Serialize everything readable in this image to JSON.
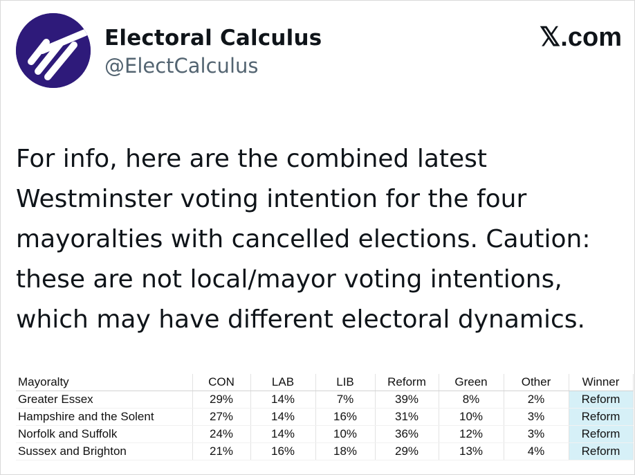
{
  "account": {
    "display_name": "Electoral Calculus",
    "handle": "@ElectCalculus",
    "brand": "𝕏.com",
    "avatar_icon": "electoral-calculus-logo",
    "avatar_color": "#2e1a7a"
  },
  "tweet": {
    "lines": [
      "For info, here are the combined latest",
      "Westminster voting intention for the four",
      "mayoralties with cancelled elections. Caution:",
      "these are not local/mayor voting intentions,",
      "which may have different electoral dynamics."
    ]
  },
  "table": {
    "headers": [
      "Mayoralty",
      "CON",
      "LAB",
      "LIB",
      "Reform",
      "Green",
      "Other",
      "Winner"
    ],
    "rows": [
      [
        "Greater Essex",
        "29%",
        "14%",
        "7%",
        "39%",
        "8%",
        "2%",
        "Reform"
      ],
      [
        "Hampshire and the Solent",
        "27%",
        "14%",
        "16%",
        "31%",
        "10%",
        "3%",
        "Reform"
      ],
      [
        "Norfolk and Suffolk",
        "24%",
        "14%",
        "10%",
        "36%",
        "12%",
        "3%",
        "Reform"
      ],
      [
        "Sussex and Brighton",
        "21%",
        "16%",
        "18%",
        "29%",
        "13%",
        "4%",
        "Reform"
      ]
    ],
    "winner_highlight": "#d6f0f7"
  }
}
